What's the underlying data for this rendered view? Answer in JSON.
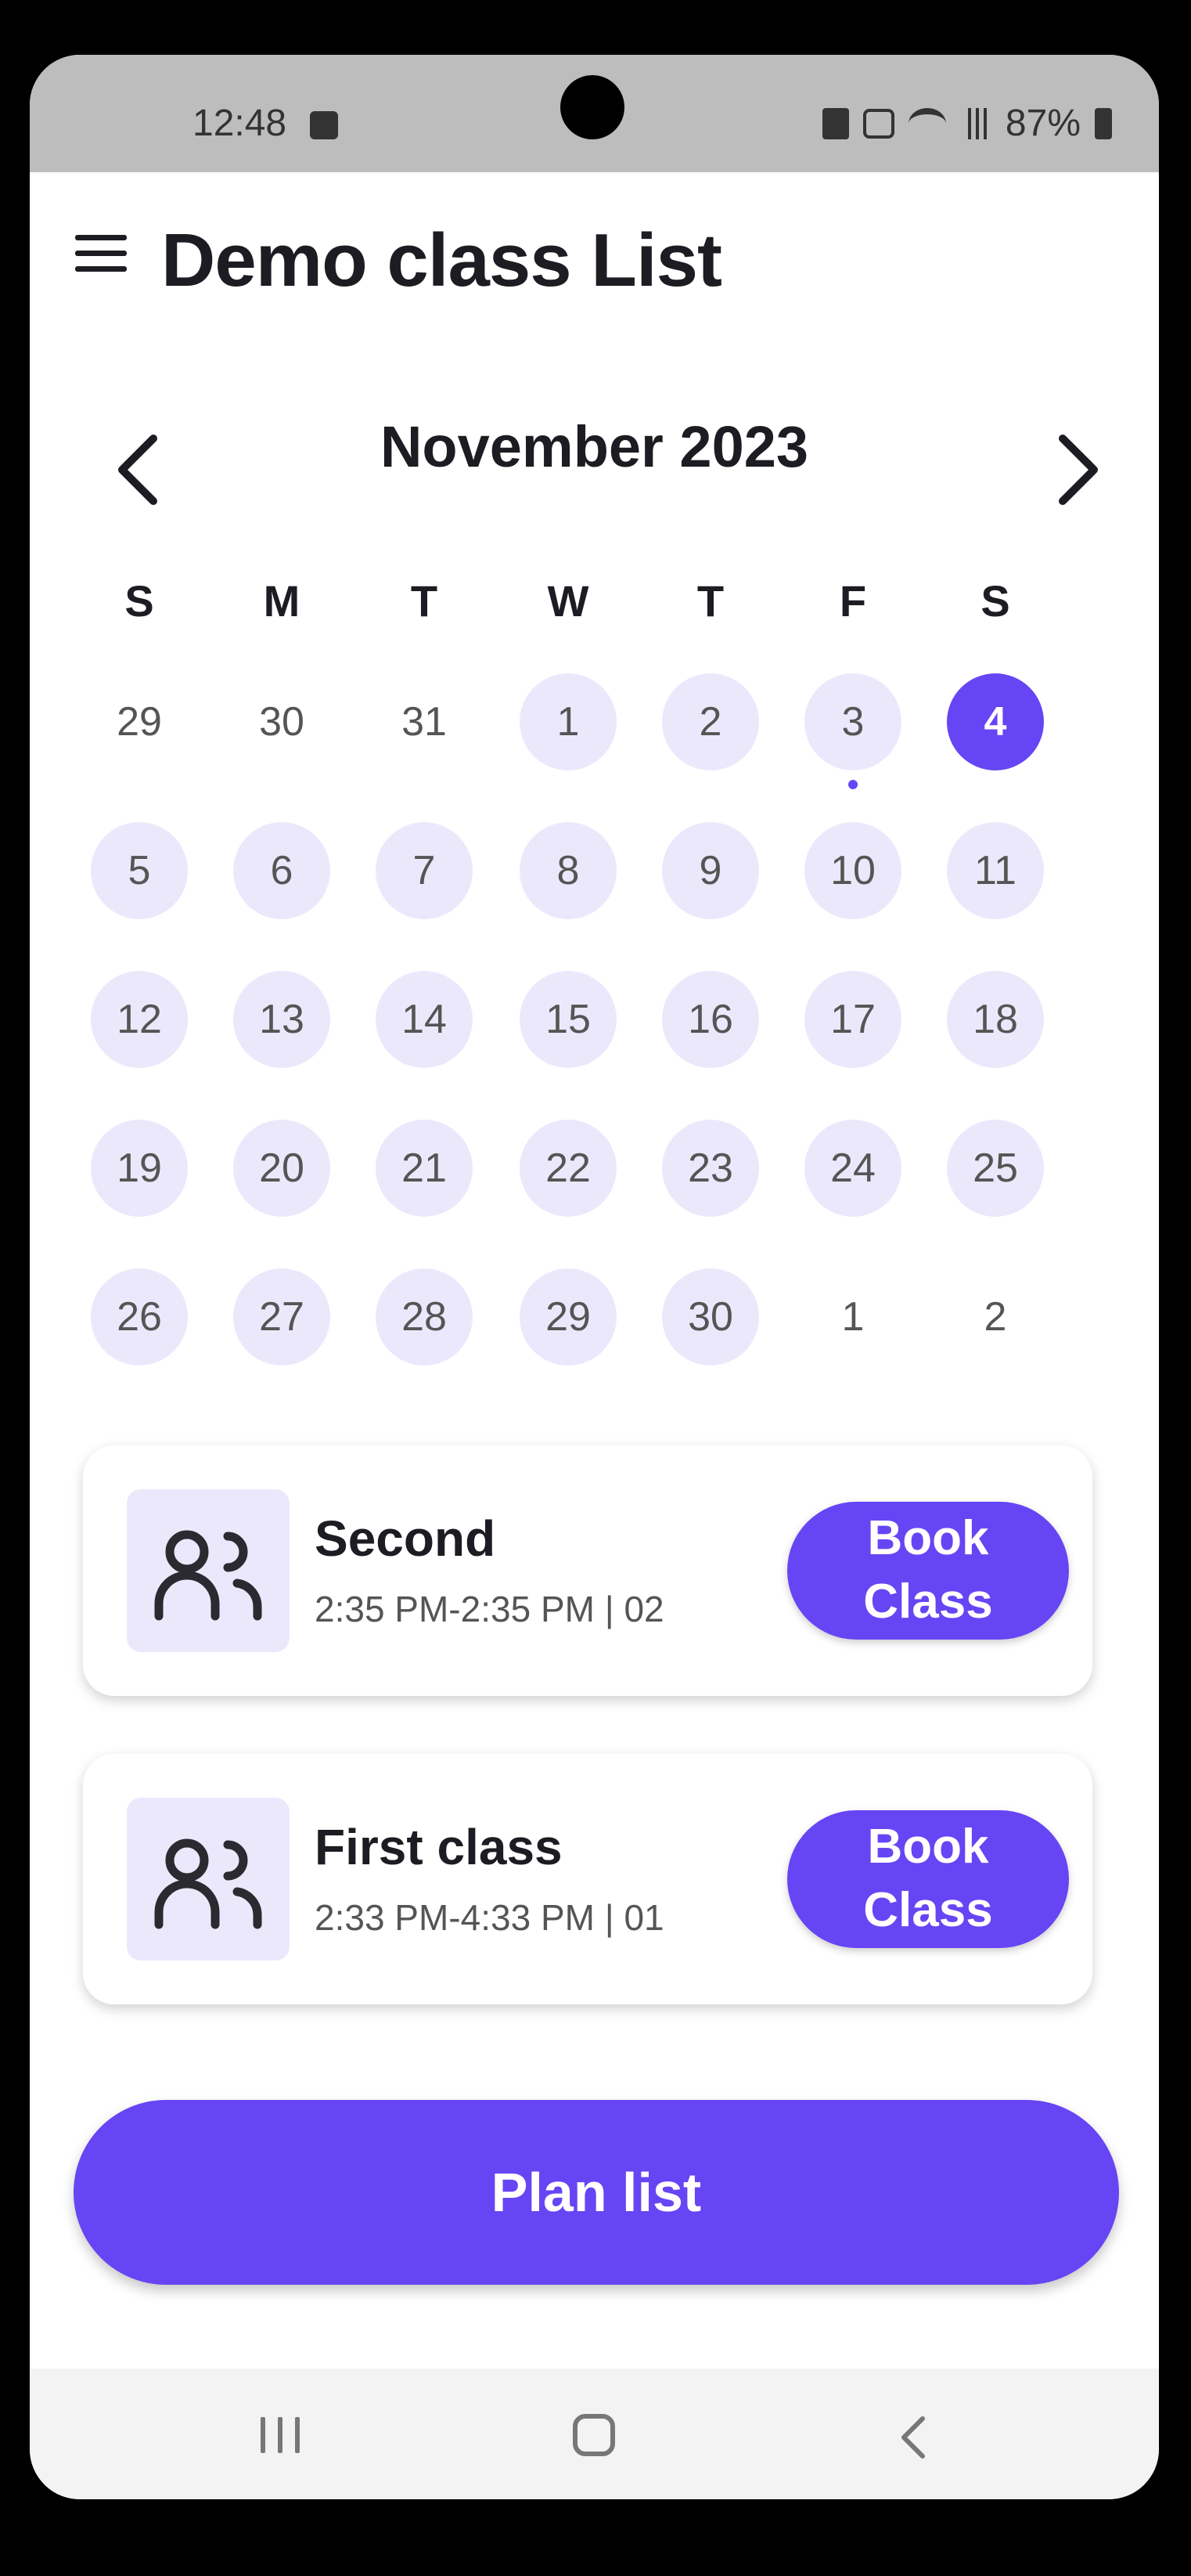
{
  "status_bar": {
    "time": "12:48",
    "battery": "87%",
    "icons": [
      "photo-icon",
      "battery-saver-icon",
      "mute-icon",
      "wifi-icon",
      "signal-icon",
      "battery-icon"
    ]
  },
  "header": {
    "title": "Demo class List",
    "menu_icon": "hamburger-menu-icon"
  },
  "calendar": {
    "month_label": "November 2023",
    "prev_icon": "chevron-left-icon",
    "next_icon": "chevron-right-icon",
    "weekdays": [
      "S",
      "M",
      "T",
      "W",
      "T",
      "F",
      "S"
    ],
    "weeks": [
      [
        {
          "d": "29",
          "in": false
        },
        {
          "d": "30",
          "in": false
        },
        {
          "d": "31",
          "in": false
        },
        {
          "d": "1",
          "in": true
        },
        {
          "d": "2",
          "in": true
        },
        {
          "d": "3",
          "in": true,
          "event": true
        },
        {
          "d": "4",
          "in": true,
          "selected": true
        }
      ],
      [
        {
          "d": "5",
          "in": true
        },
        {
          "d": "6",
          "in": true
        },
        {
          "d": "7",
          "in": true
        },
        {
          "d": "8",
          "in": true
        },
        {
          "d": "9",
          "in": true
        },
        {
          "d": "10",
          "in": true
        },
        {
          "d": "11",
          "in": true
        }
      ],
      [
        {
          "d": "12",
          "in": true
        },
        {
          "d": "13",
          "in": true
        },
        {
          "d": "14",
          "in": true
        },
        {
          "d": "15",
          "in": true
        },
        {
          "d": "16",
          "in": true
        },
        {
          "d": "17",
          "in": true
        },
        {
          "d": "18",
          "in": true
        }
      ],
      [
        {
          "d": "19",
          "in": true
        },
        {
          "d": "20",
          "in": true
        },
        {
          "d": "21",
          "in": true
        },
        {
          "d": "22",
          "in": true
        },
        {
          "d": "23",
          "in": true
        },
        {
          "d": "24",
          "in": true
        },
        {
          "d": "25",
          "in": true
        }
      ],
      [
        {
          "d": "26",
          "in": true
        },
        {
          "d": "27",
          "in": true
        },
        {
          "d": "28",
          "in": true
        },
        {
          "d": "29",
          "in": true
        },
        {
          "d": "30",
          "in": true
        },
        {
          "d": "1",
          "in": false
        },
        {
          "d": "2",
          "in": false
        }
      ]
    ],
    "selected_date": "4",
    "accent_color": "#6645f4",
    "light_color": "#ece8fc"
  },
  "classes": [
    {
      "title": "Second",
      "subtitle": "2:35 PM-2:35 PM | 02",
      "book_label_1": "Book",
      "book_label_2": "Class",
      "icon": "group-icon"
    },
    {
      "title": "First class",
      "subtitle": "2:33 PM-4:33 PM | 01",
      "book_label_1": "Book",
      "book_label_2": "Class",
      "icon": "group-icon"
    }
  ],
  "plan_button": {
    "label": "Plan list"
  },
  "nav_bar": {
    "icons": [
      "recents-icon",
      "home-icon",
      "back-icon"
    ]
  }
}
